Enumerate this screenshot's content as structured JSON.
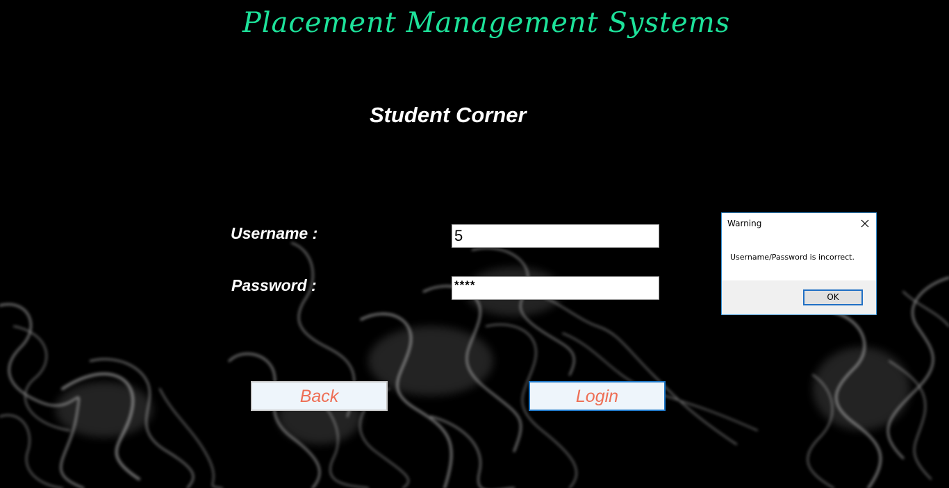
{
  "app": {
    "title": "Placement Management Systems",
    "title_color": "#1de29a",
    "background": "black smoke"
  },
  "page": {
    "heading": "Student Corner"
  },
  "form": {
    "username_label": "Username :",
    "username_value": "5",
    "password_label": "Password :",
    "password_value": "****"
  },
  "buttons": {
    "back_label": "Back",
    "login_label": "Login",
    "label_color": "#ee6e55"
  },
  "dialog": {
    "title": "Warning",
    "message": "Username/Password is incorrect.",
    "ok_label": "OK",
    "close_icon": "close-icon",
    "border_color": "#3a95d8"
  }
}
